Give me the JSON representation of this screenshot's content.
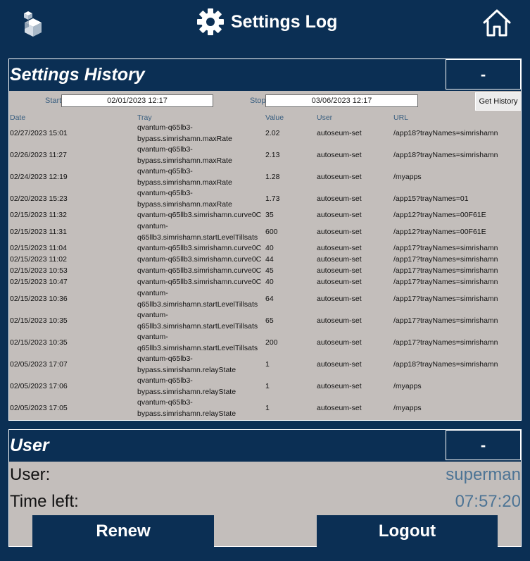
{
  "header": {
    "title": "Settings Log"
  },
  "history": {
    "title": "Settings History",
    "collapse_label": "-",
    "start_label": "Start",
    "start_value": "02/01/2023 12:17",
    "stop_label": "Stop",
    "stop_value": "03/06/2023 12:17",
    "get_history_label": "Get History",
    "columns": {
      "date": "Date",
      "tray": "Tray",
      "value": "Value",
      "user": "User",
      "url": "URL"
    },
    "rows": [
      {
        "date": "02/27/2023 15:01",
        "tray": "qvantum-q65lb3-bypass.simrishamn.maxRate",
        "value": "2.02",
        "user": "autoseum-set",
        "url": "/app18?trayNames=simrishamn"
      },
      {
        "date": "02/26/2023 11:27",
        "tray": "qvantum-q65lb3-bypass.simrishamn.maxRate",
        "value": "2.13",
        "user": "autoseum-set",
        "url": "/app18?trayNames=simrishamn"
      },
      {
        "date": "02/24/2023 12:19",
        "tray": "qvantum-q65lb3-bypass.simrishamn.maxRate",
        "value": "1.28",
        "user": "autoseum-set",
        "url": "/myapps"
      },
      {
        "date": "02/20/2023 15:23",
        "tray": "qvantum-q65lb3-bypass.simrishamn.maxRate",
        "value": "1.73",
        "user": "autoseum-set",
        "url": "/app15?trayNames=01"
      },
      {
        "date": "02/15/2023 11:32",
        "tray": "qvantum-q65llb3.simrishamn.curve0C",
        "value": "35",
        "user": "autoseum-set",
        "url": "/app12?trayNames=00F61E"
      },
      {
        "date": "02/15/2023 11:31",
        "tray": "qvantum-q65llb3.simrishamn.startLevelTillsats",
        "value": "600",
        "user": "autoseum-set",
        "url": "/app12?trayNames=00F61E"
      },
      {
        "date": "02/15/2023 11:04",
        "tray": "qvantum-q65llb3.simrishamn.curve0C",
        "value": "40",
        "user": "autoseum-set",
        "url": "/app17?trayNames=simrishamn"
      },
      {
        "date": "02/15/2023 11:02",
        "tray": "qvantum-q65llb3.simrishamn.curve0C",
        "value": "44",
        "user": "autoseum-set",
        "url": "/app17?trayNames=simrishamn"
      },
      {
        "date": "02/15/2023 10:53",
        "tray": "qvantum-q65llb3.simrishamn.curve0C",
        "value": "45",
        "user": "autoseum-set",
        "url": "/app17?trayNames=simrishamn"
      },
      {
        "date": "02/15/2023 10:47",
        "tray": "qvantum-q65llb3.simrishamn.curve0C",
        "value": "40",
        "user": "autoseum-set",
        "url": "/app17?trayNames=simrishamn"
      },
      {
        "date": "02/15/2023 10:36",
        "tray": "qvantum-q65llb3.simrishamn.startLevelTillsats",
        "value": "64",
        "user": "autoseum-set",
        "url": "/app17?trayNames=simrishamn"
      },
      {
        "date": "02/15/2023 10:35",
        "tray": "qvantum-q65llb3.simrishamn.startLevelTillsats",
        "value": "65",
        "user": "autoseum-set",
        "url": "/app17?trayNames=simrishamn"
      },
      {
        "date": "02/15/2023 10:35",
        "tray": "qvantum-q65llb3.simrishamn.startLevelTillsats",
        "value": "200",
        "user": "autoseum-set",
        "url": "/app17?trayNames=simrishamn"
      },
      {
        "date": "02/05/2023 17:07",
        "tray": "qvantum-q65lb3-bypass.simrishamn.relayState",
        "value": "1",
        "user": "autoseum-set",
        "url": "/app18?trayNames=simrishamn"
      },
      {
        "date": "02/05/2023 17:06",
        "tray": "qvantum-q65lb3-bypass.simrishamn.relayState",
        "value": "1",
        "user": "autoseum-set",
        "url": "/myapps"
      },
      {
        "date": "02/05/2023 17:05",
        "tray": "qvantum-q65lb3-bypass.simrishamn.relayState",
        "value": "1",
        "user": "autoseum-set",
        "url": "/myapps"
      }
    ]
  },
  "user_panel": {
    "title": "User",
    "collapse_label": "-",
    "user_label": "User:",
    "user_value": "superman",
    "time_label": "Time left:",
    "time_value": "07:57:20",
    "renew_label": "Renew",
    "logout_label": "Logout"
  },
  "icons": {
    "logo": "cube-logo-icon",
    "settings": "gear-icon",
    "home": "home-icon"
  },
  "colors": {
    "navy": "#0b2f54",
    "panel_bg": "#c3bebb",
    "accent_text": "#4d7495"
  }
}
